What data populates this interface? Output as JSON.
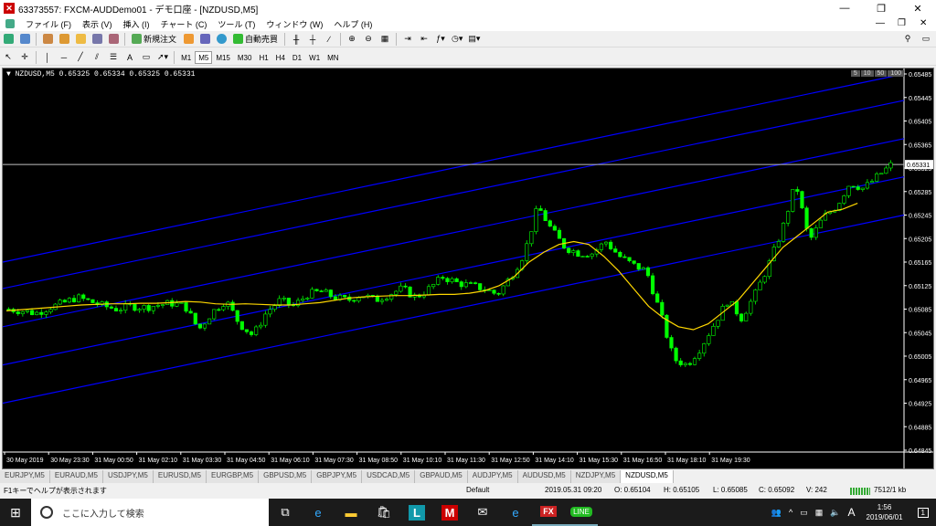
{
  "window": {
    "title": "63373557: FXCM-AUDDemo01 - デモ口座 - [NZDUSD,M5]",
    "controls": [
      "—",
      "❐",
      "✕"
    ]
  },
  "menu": {
    "items": [
      "ファイル (F)",
      "表示 (V)",
      "挿入 (I)",
      "チャート (C)",
      "ツール (T)",
      "ウィンドウ (W)",
      "ヘルプ (H)"
    ],
    "right_controls": [
      "—",
      "❐",
      "✕"
    ]
  },
  "toolbar": {
    "new_order_label": "新規注文",
    "autotrade_label": "自動売買",
    "timeframes": [
      "M1",
      "M5",
      "M15",
      "M30",
      "H1",
      "H4",
      "D1",
      "W1",
      "MN"
    ],
    "active_timeframe": "M5"
  },
  "chart": {
    "header": "▼ NZDUSD,M5  0.65325 0.65334 0.65325 0.65331",
    "scale_buttons": [
      "5",
      "10",
      "50",
      "100"
    ],
    "current_price": "0.65331",
    "colors": {
      "bull": "#00ff00",
      "bear": "#00ff00",
      "ma": "#ffd700",
      "channel": "#0000ff",
      "bid": "#c0c0c0"
    },
    "price_ticks": [
      "0.65485",
      "0.65445",
      "0.65405",
      "0.65365",
      "0.65325",
      "0.65285",
      "0.65245",
      "0.65205",
      "0.65165",
      "0.65125",
      "0.65085",
      "0.65045",
      "0.65005",
      "0.64965",
      "0.64925",
      "0.64885",
      "0.64845"
    ],
    "time_ticks": [
      "30 May 2019",
      "30 May 23:30",
      "31 May 00:50",
      "31 May 02:10",
      "31 May 03:30",
      "31 May 04:50",
      "31 May 06:10",
      "31 May 07:30",
      "31 May 08:50",
      "31 May 10:10",
      "31 May 11:30",
      "31 May 12:50",
      "31 May 14:10",
      "31 May 15:30",
      "31 May 16:50",
      "31 May 18:10",
      "31 May 19:30"
    ]
  },
  "chart_data": {
    "type": "candlestick",
    "symbol": "NZDUSD",
    "timeframe": "M5",
    "ylim": [
      0.64845,
      0.65485
    ],
    "close_path": [
      0.65085,
      0.65082,
      0.65078,
      0.65088,
      0.65095,
      0.65105,
      0.65098,
      0.6509,
      0.65085,
      0.6509,
      0.65088,
      0.65092,
      0.65095,
      0.6509,
      0.6505,
      0.6508,
      0.651,
      0.6506,
      0.6504,
      0.6508,
      0.651,
      0.6509,
      0.6511,
      0.65115,
      0.65105,
      0.651,
      0.6511,
      0.651,
      0.6511,
      0.6512,
      0.65105,
      0.6512,
      0.6514,
      0.6513,
      0.65125,
      0.6512,
      0.6511,
      0.6514,
      0.6518,
      0.6526,
      0.6522,
      0.6519,
      0.6518,
      0.6518,
      0.652,
      0.65175,
      0.6516,
      0.6515,
      0.6508,
      0.65,
      0.6499,
      0.6502,
      0.6506,
      0.651,
      0.6507,
      0.6511,
      0.6516,
      0.6522,
      0.653,
      0.652,
      0.6524,
      0.6526,
      0.653,
      0.6529,
      0.6531,
      0.6533
    ],
    "ma_path": [
      0.65082,
      0.65084,
      0.65086,
      0.65088,
      0.6509,
      0.65092,
      0.65093,
      0.65094,
      0.65094,
      0.65095,
      0.65095,
      0.65096,
      0.65098,
      0.65097,
      0.65094,
      0.65093,
      0.65094,
      0.65093,
      0.65092,
      0.65092,
      0.65094,
      0.65096,
      0.651,
      0.65104,
      0.65106,
      0.65107,
      0.65108,
      0.65108,
      0.65109,
      0.6511,
      0.6511,
      0.65112,
      0.65116,
      0.65125,
      0.6514,
      0.65165,
      0.65182,
      0.65195,
      0.652,
      0.65195,
      0.65175,
      0.6515,
      0.6512,
      0.6509,
      0.6507,
      0.65055,
      0.6505,
      0.6506,
      0.6508,
      0.651,
      0.6513,
      0.6516,
      0.6519,
      0.6521,
      0.6523,
      0.6525,
      0.65255,
      0.65265
    ],
    "current_price": 0.65331
  },
  "tabs": [
    "EURJPY,M5",
    "EURAUD,M5",
    "USDJPY,M5",
    "EURUSD,M5",
    "EURGBP,M5",
    "GBPUSD,M5",
    "GBPJPY,M5",
    "USDCAD,M5",
    "GBPAUD,M5",
    "AUDJPY,M5",
    "AUDUSD,M5",
    "NZDJPY,M5",
    "NZDUSD,M5"
  ],
  "active_tab": "NZDUSD,M5",
  "status": {
    "help": "F1キーでヘルプが表示されます",
    "profile": "Default",
    "datetime": "2019.05.31 09:20",
    "open": "O: 0.65104",
    "high": "H: 0.65105",
    "low": "L: 0.65085",
    "close": "C: 0.65092",
    "volume": "V: 242",
    "traffic": "7512/1 kb"
  },
  "taskbar": {
    "search_placeholder": "ここに入力して検索",
    "time": "1:56",
    "date": "2019/06/01",
    "ime": "A",
    "notif_count": "1"
  }
}
